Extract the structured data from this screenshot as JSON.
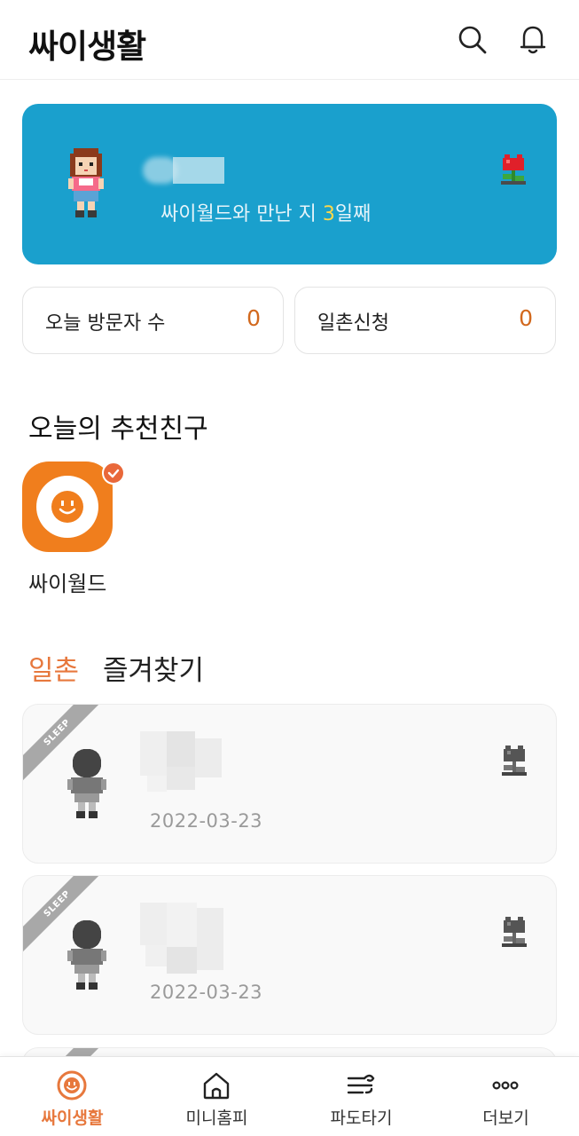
{
  "header": {
    "title": "싸이생활",
    "search_icon": "search-icon",
    "bell_icon": "bell-icon"
  },
  "profile": {
    "days_prefix": "싸이월드와 만난 지 ",
    "days_number": "3",
    "days_suffix": "일째"
  },
  "stats": [
    {
      "label": "오늘 방문자 수",
      "value": "0"
    },
    {
      "label": "일촌신청",
      "value": "0"
    }
  ],
  "recommended": {
    "title": "오늘의 추천친구",
    "friends": [
      {
        "name": "싸이월드"
      }
    ]
  },
  "tabs": [
    {
      "label": "일촌",
      "active": true
    },
    {
      "label": "즐겨찾기",
      "active": false
    }
  ],
  "friends": [
    {
      "badge": "SLEEP",
      "date": "2022-03-23"
    },
    {
      "badge": "SLEEP",
      "date": "2022-03-23"
    }
  ],
  "nav": [
    {
      "label": "싸이생활",
      "icon": "cyworld-face-icon",
      "active": true
    },
    {
      "label": "미니홈피",
      "icon": "home-icon",
      "active": false
    },
    {
      "label": "파도타기",
      "icon": "wave-icon",
      "active": false
    },
    {
      "label": "더보기",
      "icon": "more-icon",
      "active": false
    }
  ],
  "colors": {
    "accent": "#e7783d",
    "banner": "#1aa0cd",
    "stat_value": "#d2691e"
  }
}
